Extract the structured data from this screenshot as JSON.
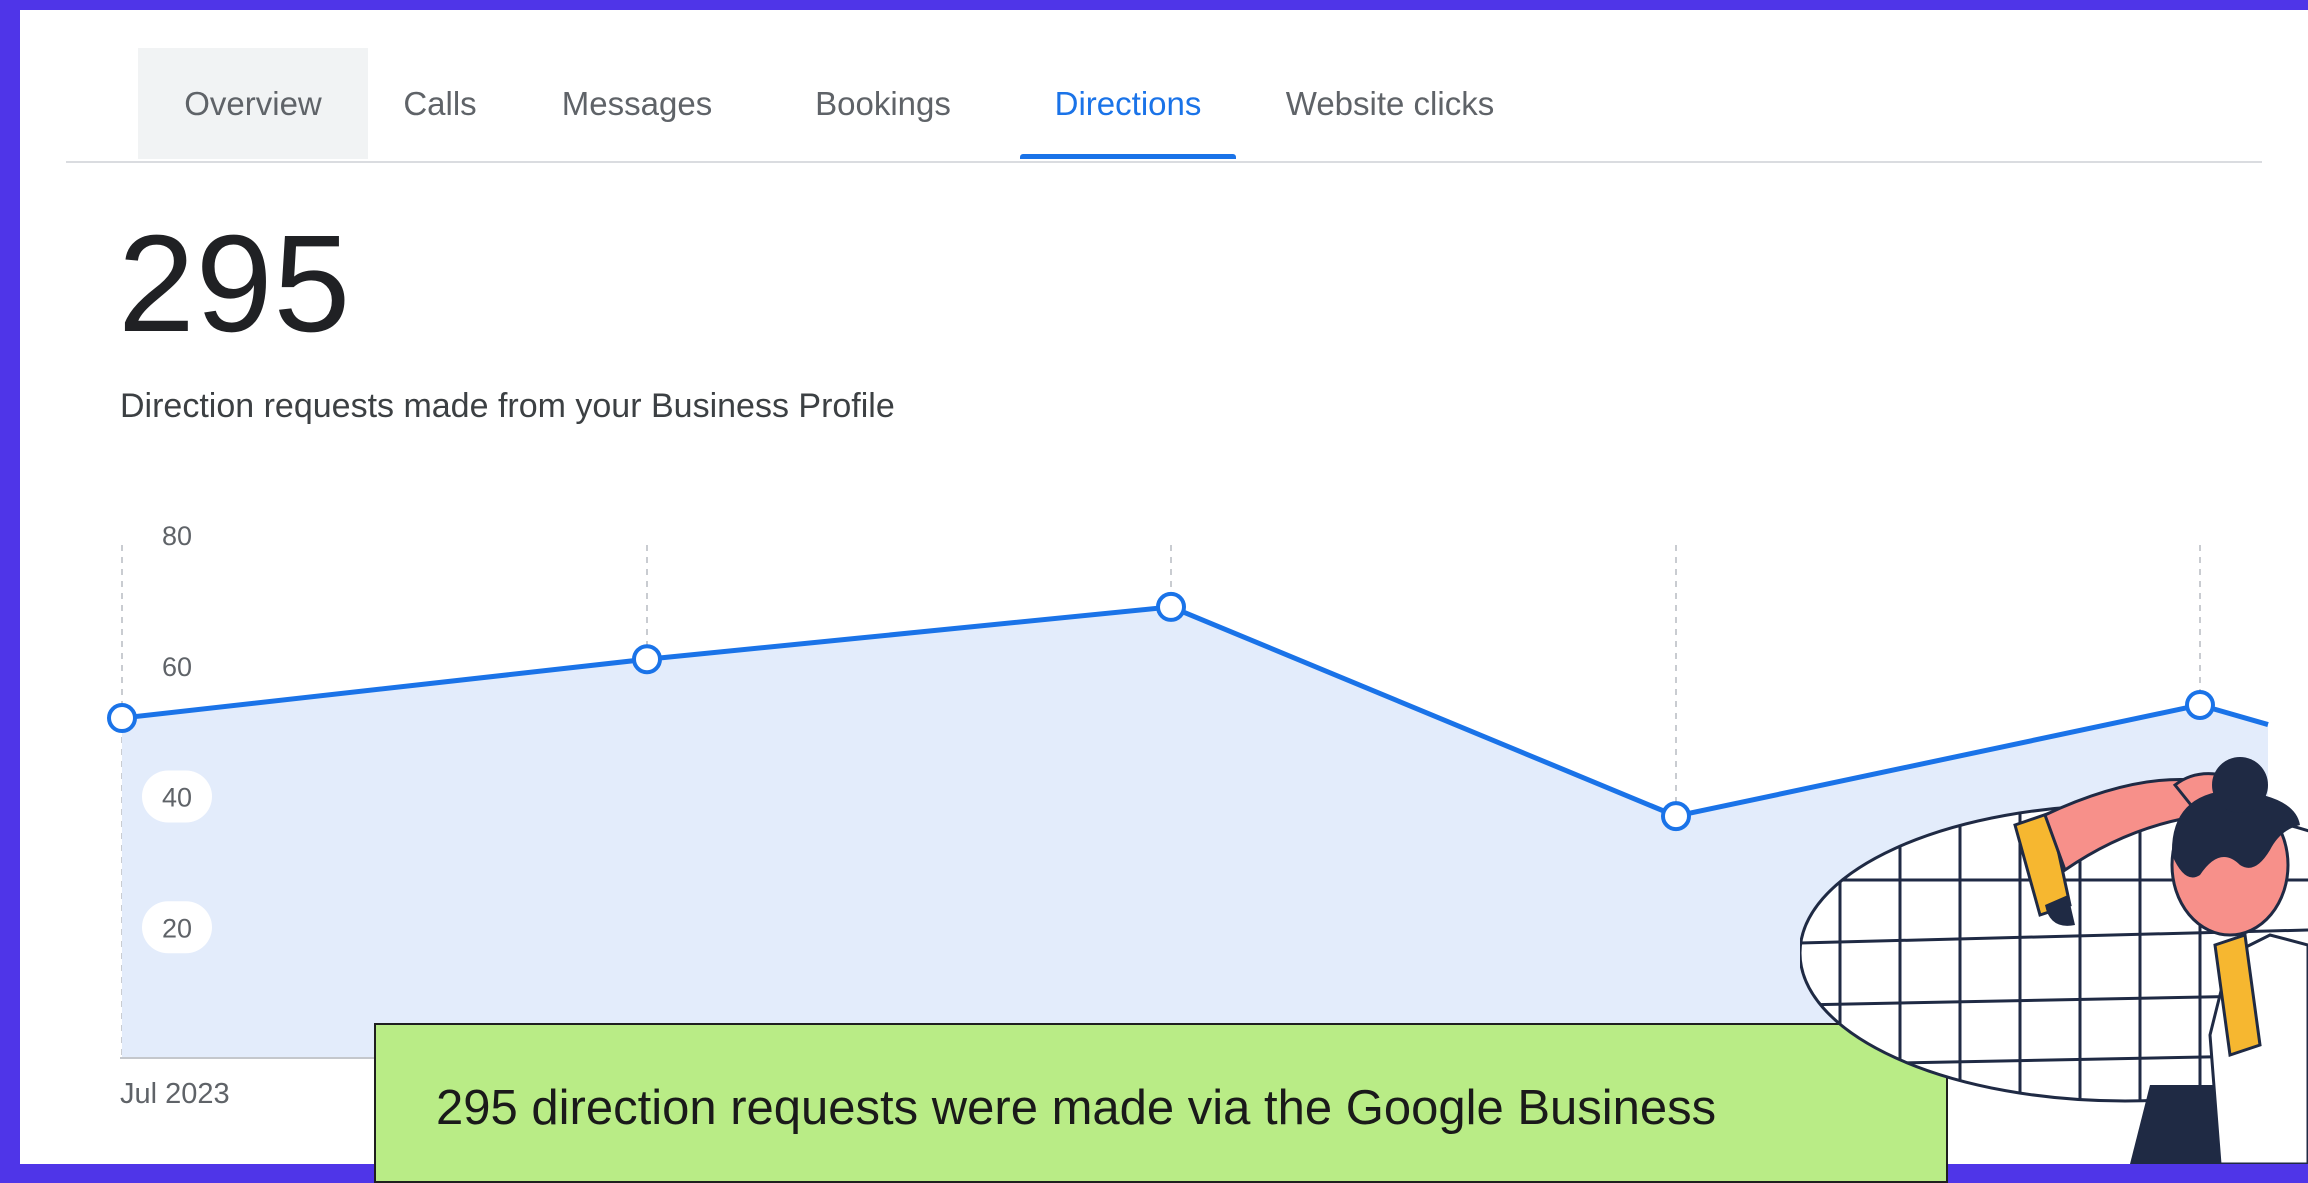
{
  "tabs": [
    {
      "label": "Overview"
    },
    {
      "label": "Calls"
    },
    {
      "label": "Messages"
    },
    {
      "label": "Bookings"
    },
    {
      "label": "Directions"
    },
    {
      "label": "Website clicks"
    }
  ],
  "active_tab": "Directions",
  "summary": {
    "total": "295",
    "description": "Direction requests made from your Business Profile"
  },
  "chart_data": {
    "type": "area",
    "x": [
      "Jul 2023",
      "",
      "",
      "",
      ""
    ],
    "values": [
      52,
      61,
      69,
      37,
      54
    ],
    "y_ticks": [
      "80",
      "60",
      "40",
      "20"
    ],
    "ylim": [
      0,
      80
    ],
    "grid": "vertical dashed",
    "line_color": "#1a73e8",
    "fill_color": "#e3ecfb"
  },
  "callout": {
    "text": "295 direction requests were made via the Google Business"
  },
  "colors": {
    "frame": "#4f35e8",
    "accent": "#1a73e8",
    "callout_bg": "#b9ec86"
  }
}
